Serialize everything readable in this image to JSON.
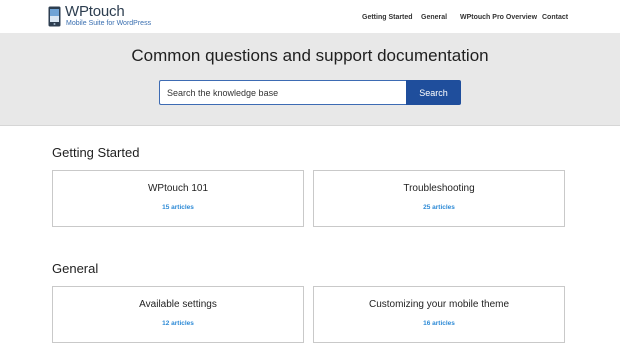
{
  "header": {
    "logo_title": "WPtouch",
    "logo_tagline": "Mobile Suite for WordPress",
    "logo_icon": "phone-logo-icon",
    "nav": [
      {
        "label": "Getting Started"
      },
      {
        "label": "General"
      },
      {
        "label": "WPtouch Pro Overview"
      },
      {
        "label": "Contact"
      }
    ]
  },
  "hero": {
    "title": "Common questions and support documentation",
    "search": {
      "placeholder": "Search the knowledge base",
      "button_label": "Search"
    }
  },
  "sections": [
    {
      "title": "Getting Started",
      "cards": [
        {
          "title": "WPtouch 101",
          "count": "15 articles"
        },
        {
          "title": "Troubleshooting",
          "count": "25 articles"
        }
      ]
    },
    {
      "title": "General",
      "cards": [
        {
          "title": "Available settings",
          "count": "12 articles"
        },
        {
          "title": "Customizing your mobile theme",
          "count": "16 articles"
        }
      ]
    }
  ],
  "colors": {
    "brand_blue": "#1f4e9c",
    "link_blue": "#2d8ad6",
    "hero_bg": "#e8e8e8"
  }
}
